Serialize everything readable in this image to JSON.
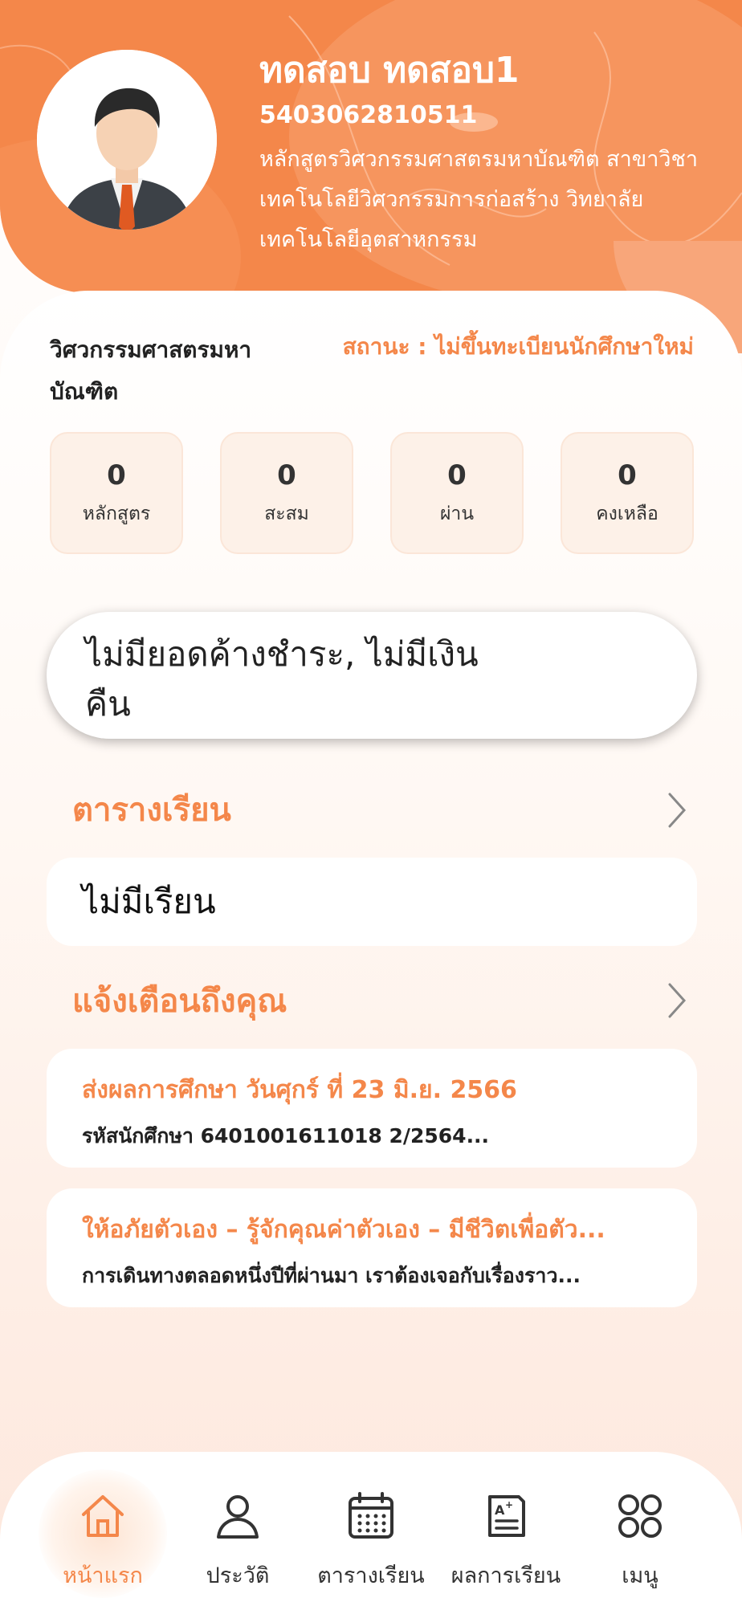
{
  "profile": {
    "name": "ทดสอบ ทดสอบ1",
    "student_id": "5403062810511",
    "program": "หลักสูตรวิศวกรรมศาสตรมหาบัณฑิต สาขาวิชาเทคโนโลยีวิศวกรรมการก่อสร้าง วิทยาลัยเทคโนโลยีอุตสาหกรรม",
    "degree": "วิศวกรรมศาสตรมหาบัณฑิต",
    "status": "สถานะ : ไม่ขึ้นทะเบียนนักศึกษาใหม่"
  },
  "stats": [
    {
      "value": "0",
      "label": "หลักสูตร"
    },
    {
      "value": "0",
      "label": "สะสม"
    },
    {
      "value": "0",
      "label": "ผ่าน"
    },
    {
      "value": "0",
      "label": "คงเหลือ"
    }
  ],
  "balance": {
    "text": "ไม่มียอดค้างชำระ, ไม่มีเงินคืน"
  },
  "schedule": {
    "title": "ตารางเรียน",
    "empty_text": "ไม่มีเรียน"
  },
  "notifications": {
    "title": "แจ้งเตือนถึงคุณ",
    "items": [
      {
        "title": "ส่งผลการศึกษา วันศุกร์ ที่ 23 มิ.ย. 2566",
        "desc": "รหัสนักศึกษา 6401001611018 2/2564..."
      },
      {
        "title": "ให้อภัยตัวเอง – รู้จักคุณค่าตัวเอง – มีชีวิตเพื่อตัว...",
        "desc": "การเดินทางตลอดหนึ่งปีที่ผ่านมา เราต้องเจอกับเรื่องราว..."
      }
    ]
  },
  "nav": [
    {
      "label": "หน้าแรก",
      "icon": "home-icon",
      "active": true
    },
    {
      "label": "ประวัติ",
      "icon": "user-icon"
    },
    {
      "label": "ตารางเรียน",
      "icon": "calendar-icon"
    },
    {
      "label": "ผลการเรียน",
      "icon": "grade-report-icon"
    },
    {
      "label": "เมนู",
      "icon": "menu-grid-icon"
    }
  ],
  "colors": {
    "accent": "#f4874a",
    "header_bg": "#f4874a"
  }
}
